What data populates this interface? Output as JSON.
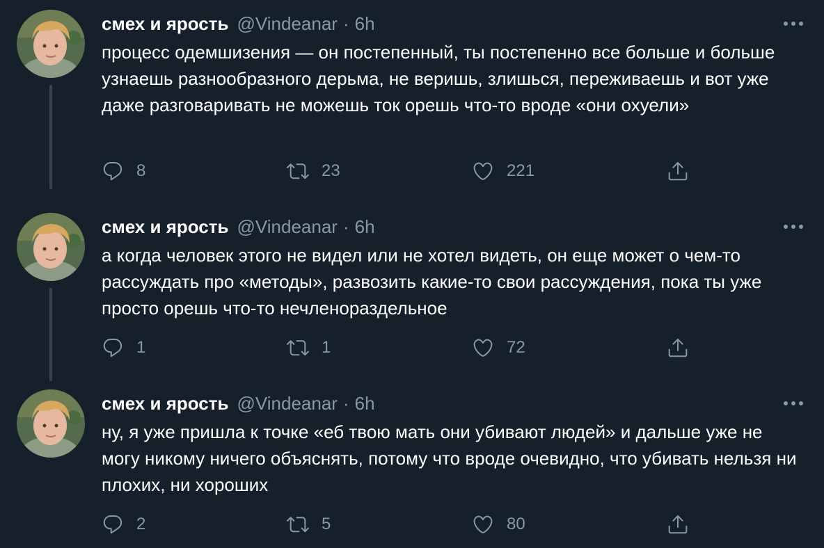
{
  "tweets": [
    {
      "name": "смех и ярость",
      "handle": "@Vindeanar",
      "separator": "·",
      "time": "6h",
      "text": "процесс одемшизения — он постепенный, ты постепенно все больше и больше узнаешь разнообразного дерьма, не веришь, злишься, переживаешь и вот уже даже разговаривать не можешь ток орешь что-то вроде «они охуели»",
      "replies": "8",
      "retweets": "23",
      "likes": "221"
    },
    {
      "name": "смех и ярость",
      "handle": "@Vindeanar",
      "separator": "·",
      "time": "6h",
      "text": "а когда человек этого не видел или не хотел видеть, он еще может о чем-то рассуждать про «методы», развозить какие-то свои рассуждения, пока ты уже просто орешь что-то нечленораздельное",
      "replies": "1",
      "retweets": "1",
      "likes": "72"
    },
    {
      "name": "смех и ярость",
      "handle": "@Vindeanar",
      "separator": "·",
      "time": "6h",
      "text": "ну, я уже пришла к точке «еб твою мать они убивают людей» и дальше уже не могу никому ничего объяснять, потому что вроде очевидно, что убивать нельзя ни плохих, ни хороших",
      "replies": "2",
      "retweets": "5",
      "likes": "80"
    }
  ],
  "icons": {
    "reply": "reply-icon",
    "retweet": "retweet-icon",
    "like": "heart-icon",
    "share": "share-icon",
    "more": "more-icon",
    "avatar": "avatar"
  },
  "colors": {
    "background": "#15202b",
    "primary_text": "#ffffff",
    "secondary_text": "#8899a6",
    "thread_line": "#38444d"
  }
}
